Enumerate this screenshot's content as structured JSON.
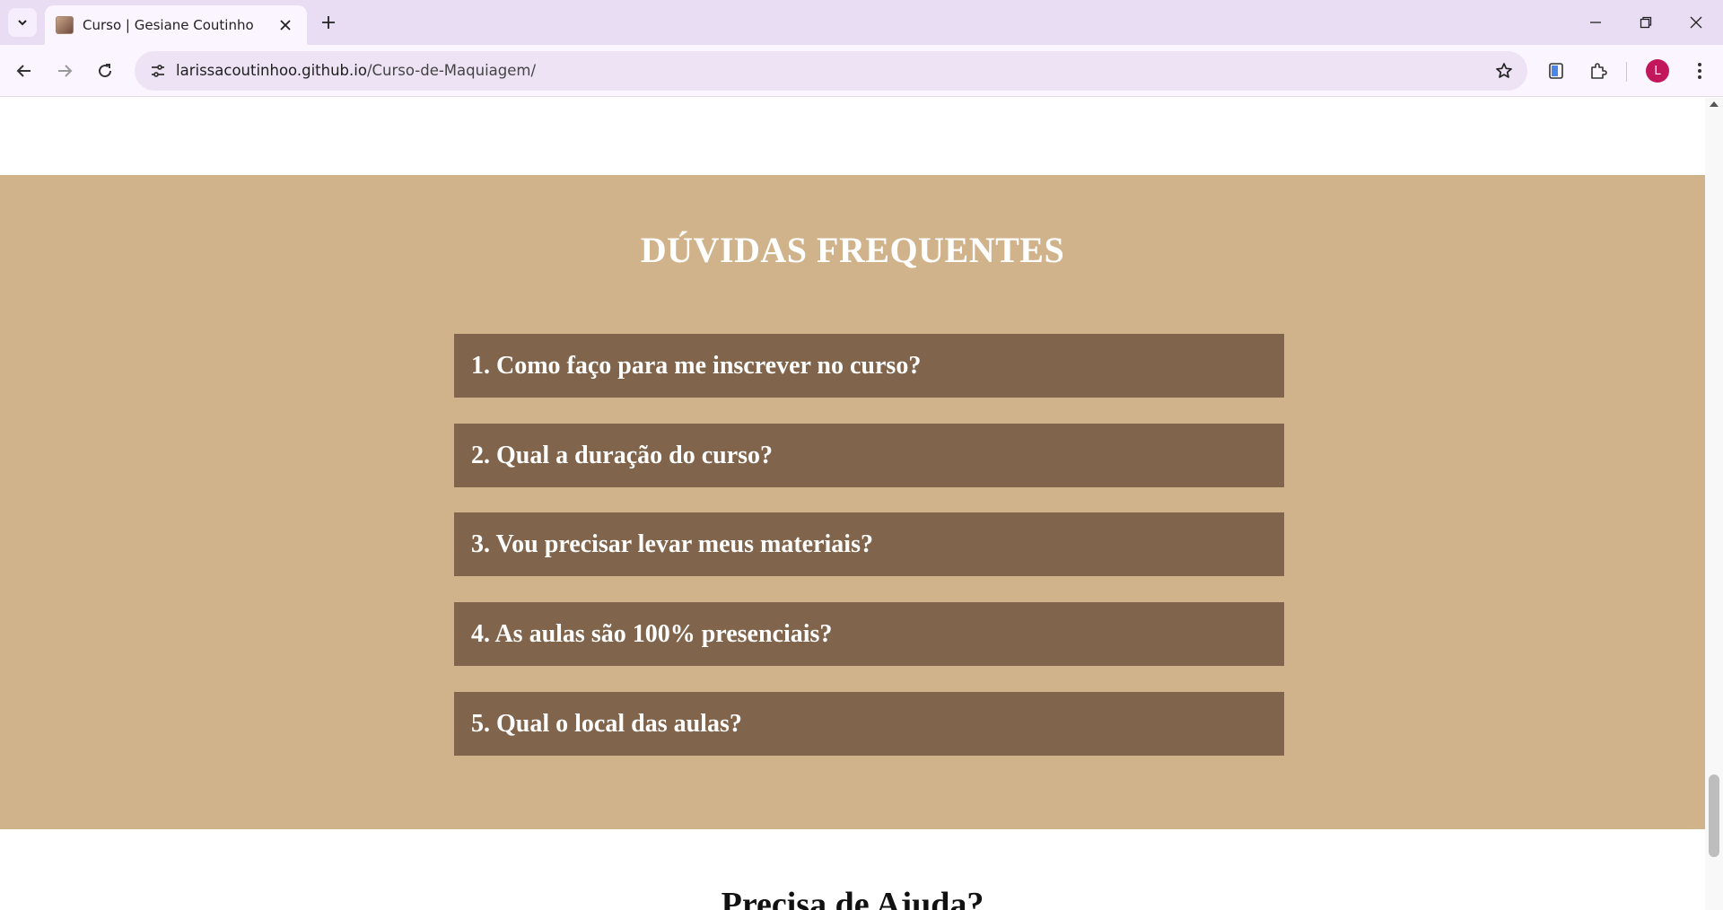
{
  "browser": {
    "tab": {
      "title": "Curso | Gesiane Coutinho"
    },
    "address": {
      "host": "larissacoutinhoo.github.io",
      "path": "/Curso-de-Maquiagem/"
    },
    "profile": {
      "initial": "L",
      "color": "#c2185b"
    },
    "icons": {
      "tab_list": "chevron-down-icon",
      "close_tab": "close-icon",
      "new_tab": "plus-icon",
      "back": "arrow-left-icon",
      "forward": "arrow-right-icon",
      "reload": "reload-icon",
      "site_info": "tune-icon",
      "bookmark": "star-icon",
      "side_panel": "reading-mode-icon",
      "extensions": "puzzle-icon",
      "menu": "kebab-menu-icon",
      "minimize": "minimize-icon",
      "restore": "restore-icon",
      "close_window": "close-icon"
    }
  },
  "page": {
    "faq": {
      "title": "DÚVIDAS FREQUENTES",
      "background": "#d1b38b",
      "item_color": "#80644b",
      "items": [
        {
          "label": "1. Como faço para me inscrever no curso?"
        },
        {
          "label": "2. Qual a duração do curso?"
        },
        {
          "label": "3. Vou precisar levar meus materiais?"
        },
        {
          "label": "4. As aulas são 100% presenciais?"
        },
        {
          "label": "5. Qual o local das aulas?"
        }
      ]
    },
    "help": {
      "title": "Precisa de Ajuda?"
    }
  }
}
